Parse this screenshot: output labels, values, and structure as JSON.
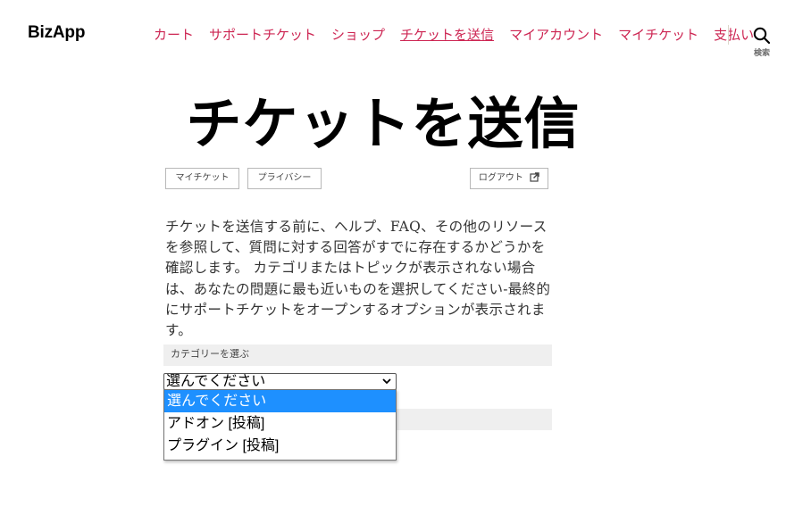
{
  "brand": "BizApp",
  "nav": [
    "カート",
    "サポートチケット",
    "ショップ",
    "チケットを送信",
    "マイアカウント",
    "マイチケット",
    "支払い"
  ],
  "search_label": "検索",
  "title": "チケットを送信",
  "buttons": {
    "my_tickets": "マイチケット",
    "privacy": "プライバシー",
    "logout": "ログアウト"
  },
  "intro_text": "チケットを送信する前に、ヘルプ、FAQ、その他のリソースを参照して、質問に対する回答がすでに存在するかどうかを確認します。 カテゴリまたはトピックが表示されない場合は、あなたの問題に最も近いものを選択してください-最終的にサポートチケットをオープンするオプションが表示されます。",
  "category": {
    "label": "カテゴリーを選ぶ",
    "selected": "選んでください",
    "options": [
      "選んでください",
      "アドオン [投稿]",
      "プラグイン [投稿]"
    ]
  },
  "colors": {
    "link": "#cd2653",
    "selected_option": "#1e90ff"
  }
}
